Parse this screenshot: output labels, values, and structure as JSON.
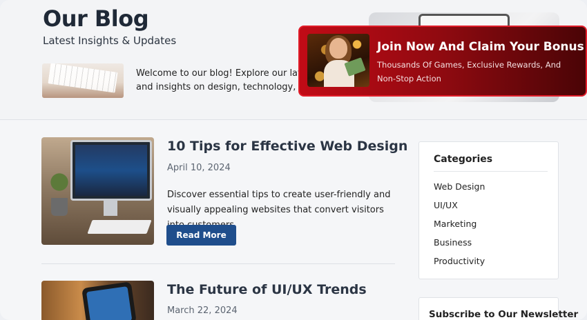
{
  "header": {
    "title": "Our Blog",
    "subtitle": "Latest Insights & Updates",
    "welcome_line1": "Welcome to our blog! Explore our lat arti",
    "welcome_line2": "and insights on design, technology, business"
  },
  "ad": {
    "title": "Join Now And Claim Your Bonus",
    "subtitle": "Thousands Of Games, Exclusive Rewards, And Non-Stop Action",
    "border_color": "#e11d2a",
    "background_color": "#b00a14"
  },
  "posts": [
    {
      "title": "10 Tips for Effective Web Design",
      "date": "April 10, 2024",
      "excerpt": "Discover essential tips to create user-friendly and visually appealing websites that convert visitors into customers.",
      "button_label": "Read More"
    },
    {
      "title": "The Future of UI/UX Trends",
      "date": "March 22, 2024"
    }
  ],
  "sidebar": {
    "categories_title": "Categories",
    "categories": [
      "Web Design",
      "UI/UX",
      "Marketing",
      "Business",
      "Productivity"
    ],
    "newsletter_title": "Subscribe to Our Newsletter"
  },
  "colors": {
    "button": "#1f4e8c",
    "page_background": "#f5f6f8"
  }
}
